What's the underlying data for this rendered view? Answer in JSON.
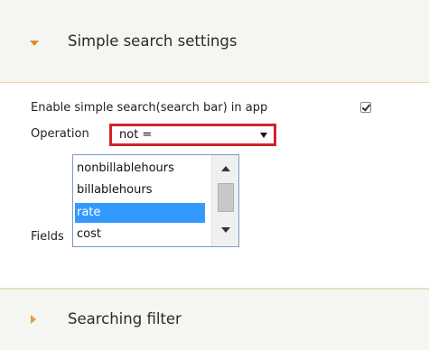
{
  "sections": {
    "simple_search": {
      "title": "Simple search settings",
      "expanded": true
    },
    "searching_filter": {
      "title": "Searching filter",
      "expanded": false
    }
  },
  "settings": {
    "enable_label": "Enable simple search(search bar) in app",
    "enable_checked": true,
    "operation_label": "Operation",
    "operation_value": "not =",
    "fields_label": "Fields"
  },
  "fields_list": {
    "items": [
      {
        "label": "nonbillablehours",
        "selected": false
      },
      {
        "label": "billablehours",
        "selected": false
      },
      {
        "label": "rate",
        "selected": true
      },
      {
        "label": "cost",
        "selected": false
      }
    ]
  },
  "colors": {
    "accent": "#e08a24",
    "highlight_outline": "#d0232a",
    "selection": "#3399ff"
  }
}
